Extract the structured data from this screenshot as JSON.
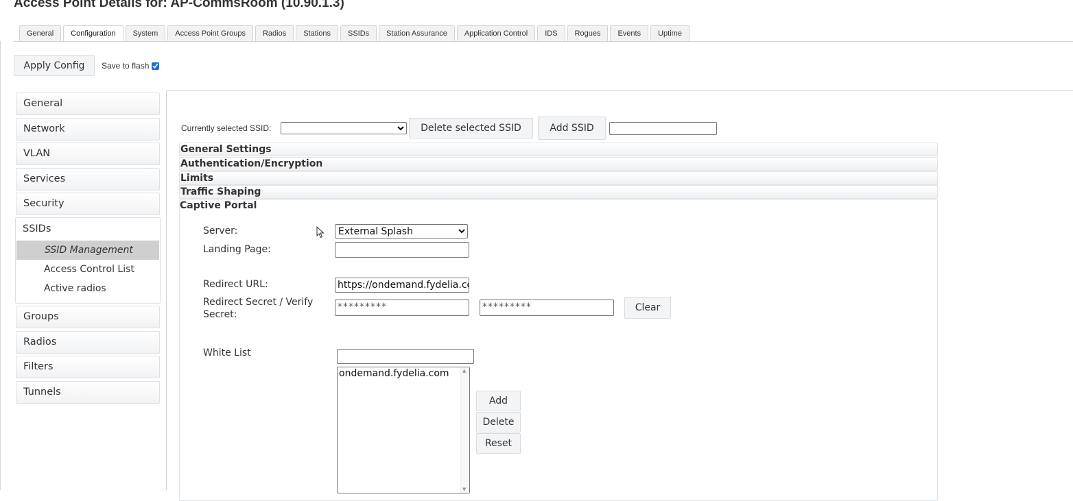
{
  "title": "Access Point Details for: AP-CommsRoom (10.90.1.3)",
  "tabs": [
    {
      "label": "General",
      "active": false
    },
    {
      "label": "Configuration",
      "active": true
    },
    {
      "label": "System",
      "active": false
    },
    {
      "label": "Access Point Groups",
      "active": false
    },
    {
      "label": "Radios",
      "active": false
    },
    {
      "label": "Stations",
      "active": false
    },
    {
      "label": "SSIDs",
      "active": false
    },
    {
      "label": "Station Assurance",
      "active": false
    },
    {
      "label": "Application Control",
      "active": false
    },
    {
      "label": "IDS",
      "active": false
    },
    {
      "label": "Rogues",
      "active": false
    },
    {
      "label": "Events",
      "active": false
    },
    {
      "label": "Uptime",
      "active": false
    }
  ],
  "toolbar": {
    "apply_label": "Apply Config",
    "save_flash_label": "Save to flash",
    "save_flash_checked": true
  },
  "sidebar": {
    "items": [
      "General",
      "Network",
      "VLAN",
      "Services",
      "Security"
    ],
    "ssids_label": "SSIDs",
    "ssids_sub": [
      "SSID Management",
      "Access Control List",
      "Active radios"
    ],
    "items_after": [
      "Groups",
      "Radios",
      "Filters",
      "Tunnels"
    ]
  },
  "ssid_bar": {
    "label": "Currently selected SSID:",
    "selected": "",
    "delete_label": "Delete selected SSID",
    "add_label": "Add SSID",
    "new_ssid_value": ""
  },
  "sections": [
    "General Settings",
    "Authentication/Encryption",
    "Limits",
    "Traffic Shaping"
  ],
  "captive_portal": {
    "title": "Captive Portal",
    "server_label": "Server:",
    "server_value": "External Splash",
    "landing_label": "Landing Page:",
    "landing_value": "",
    "redirect_label": "Redirect URL:",
    "redirect_value": "https://ondemand.fydelia.com",
    "secret_label": "Redirect Secret / Verify Secret:",
    "secret_value": "*********",
    "verify_value": "*********",
    "clear_label": "Clear",
    "whitelist_label": "White List",
    "whitelist_input": "",
    "whitelist_items": [
      "ondemand.fydelia.com"
    ],
    "add_label": "Add",
    "delete_label": "Delete",
    "reset_label": "Reset"
  }
}
